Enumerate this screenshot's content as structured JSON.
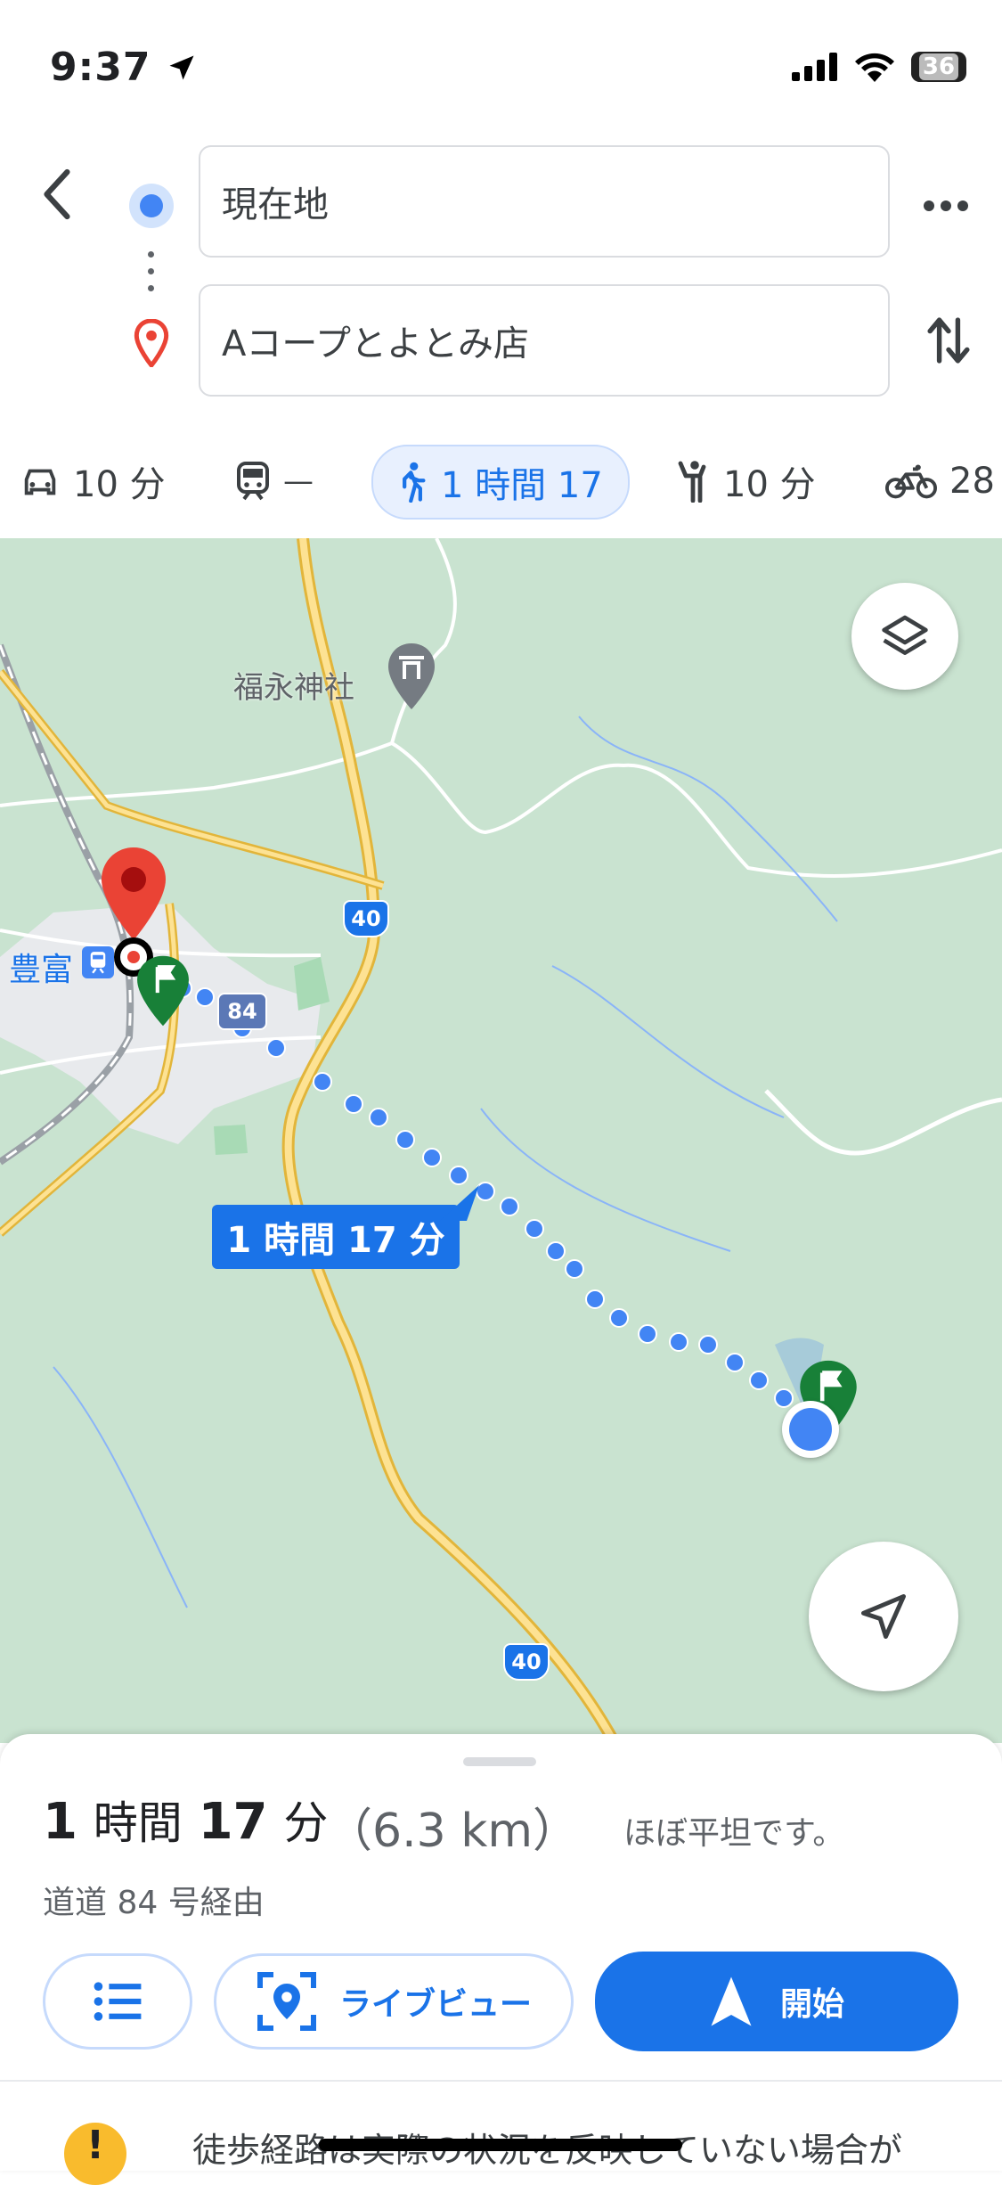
{
  "status_bar": {
    "time": "9:37",
    "battery": "36"
  },
  "route": {
    "origin": "現在地",
    "destination": "Aコープとよとみ店"
  },
  "modes": [
    {
      "name": "car",
      "label": "10 分"
    },
    {
      "name": "transit",
      "label": "—"
    },
    {
      "name": "walk",
      "label": "1 時間 17",
      "active": true
    },
    {
      "name": "rideshare",
      "label": "10 分"
    },
    {
      "name": "bike",
      "label": "28"
    }
  ],
  "map": {
    "places": {
      "shrine": "福永神社",
      "station": "豊富"
    },
    "route_shields": [
      "40",
      "84",
      "40"
    ],
    "route_label": "1 時間 17 分"
  },
  "sheet": {
    "duration_hours": "1",
    "duration_unit_h": "時間",
    "duration_minutes": "17",
    "duration_unit_m": "分",
    "distance": "（6.3 km）",
    "terrain": "ほぼ平坦です。",
    "via": "道道 84 号経由",
    "liveview_label": "ライブビュー",
    "start_label": "開始",
    "warning": "徒歩経路は実際の状況を反映していない場合が"
  },
  "colors": {
    "accent": "#1a73e8",
    "pin": "#ea4335",
    "map_bg": "#c9e3d0",
    "road": "#f6c342"
  }
}
